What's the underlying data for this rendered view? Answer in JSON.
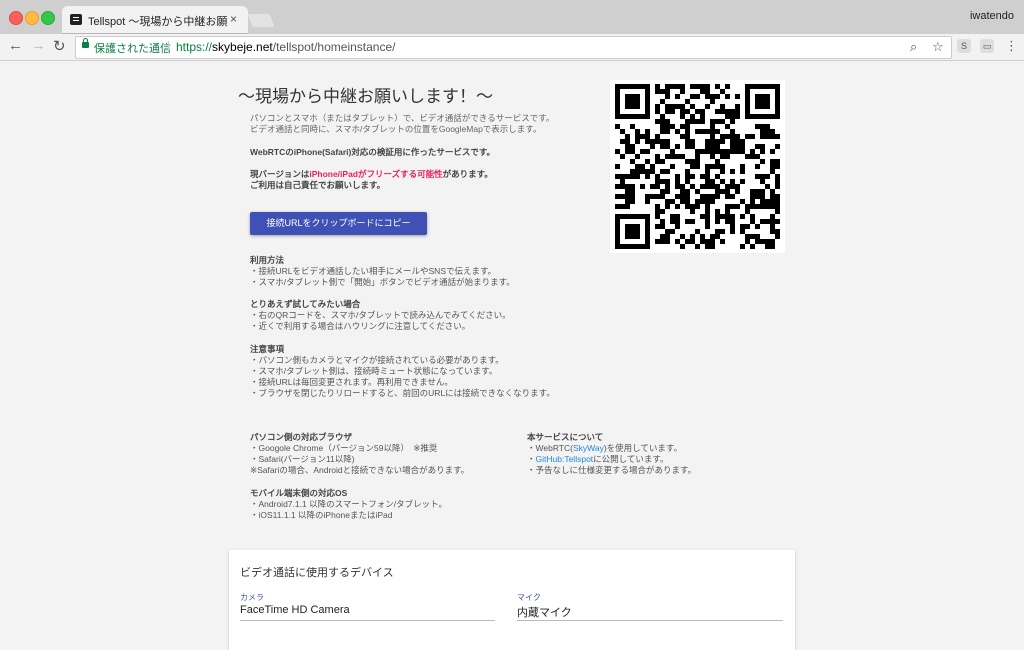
{
  "browser": {
    "tab_title": "Tellspot 〜現場から中継お願いし",
    "tab_close": "×",
    "profile_name": "iwatendo",
    "secure_label": "保護された通信",
    "url_scheme": "https://",
    "url_host": "skybeje.net",
    "url_path": "/tellspot/homeinstance/",
    "back_icon": "←",
    "forward_icon": "→",
    "reload_icon": "↻",
    "search_icon": "⌕",
    "star_icon": "☆",
    "ext1": "S",
    "ext2": "▭",
    "menu_icon": "⋮"
  },
  "main": {
    "headline": "〜現場から中継お願いします！〜",
    "intro_line1": "パソコンとスマホ（またはタブレット）で、ビデオ通話ができるサービスです。",
    "intro_line2": "ビデオ通話と同時に、スマホ/タブレットの位置をGoogleMapで表示します。",
    "webrtc_note": "WebRTCのiPhone(Safari)対応の検証用に作ったサービスです。",
    "warning_prefix": "現バージョンは",
    "warning_red": "iPhone/iPadがフリーズする可能性",
    "warning_suffix": "があります。",
    "warning_line2": "ご利用は自己責任でお願いします。",
    "copy_button": "接続URLをクリップボードにコピー",
    "usage_title": "利用方法",
    "usage_1": "・接続URLをビデオ通話したい相手にメールやSNSで伝えます。",
    "usage_2": "・スマホ/タブレット側で「開始」ボタンでビデオ通話が始まります。",
    "try_title": "とりあえず試してみたい場合",
    "try_1": "・右のQRコードを、スマホ/タブレットで読み込んでみてください。",
    "try_2": "・近くで利用する場合はハウリングに注意してください。",
    "notes_title": "注意事項",
    "notes_1": "・パソコン側もカメラとマイクが接続されている必要があります。",
    "notes_2": "・スマホ/タブレット側は、接続時ミュート状態になっています。",
    "notes_3": "・接続URLは毎回変更されます。再利用できません。",
    "notes_4": "・ブラウザを閉じたりリロードすると、前回のURLには接続できなくなります。",
    "pc_title": "パソコン側の対応ブラウザ",
    "pc_1": "・Googole Chrome（バージョン59以降）　※推奨",
    "pc_2": "・Safari(バージョン11以降)",
    "pc_3": "※Safariの場合、Androidと接続できない場合があります。",
    "mobile_title": "モバイル端末側の対応OS",
    "mobile_1": "・Android7.1.1 以降のスマートフォン/タブレット。",
    "mobile_2": "・iOS11.1.1 以降のiPhoneまたはiPad",
    "about_title": "本サービスについて",
    "about_1_prefix": "・WebRTC(",
    "about_1_link": "SkyWay",
    "about_1_suffix": ")を使用しています。",
    "about_2_prefix": "・",
    "about_2_link": "GitHub:Tellspot",
    "about_2_suffix": "に公開しています。",
    "about_3": "・予告なしに仕様変更する場合があります。"
  },
  "devices": {
    "title": "ビデオ通話に使用するデバイス",
    "camera_label": "カメラ",
    "camera_value": "FaceTime HD Camera",
    "mic_label": "マイク",
    "mic_value": "内蔵マイク"
  },
  "colors": {
    "accent": "#3f51b5",
    "warning": "#e91e63",
    "secure": "#0b8043",
    "link": "#1e88e5"
  }
}
